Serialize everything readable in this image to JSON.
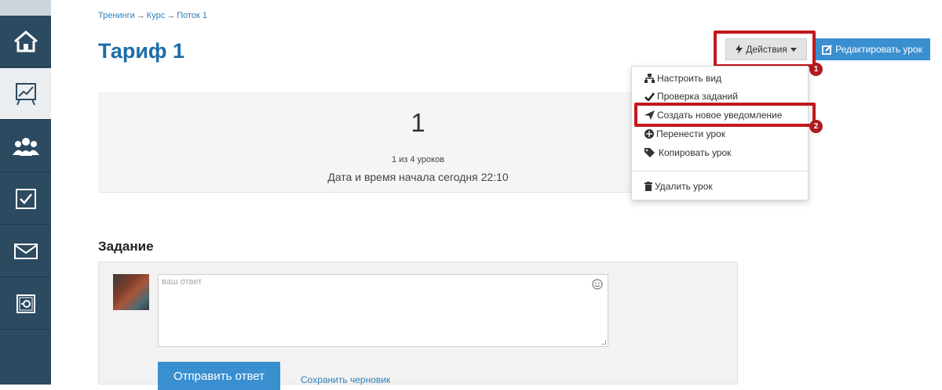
{
  "breadcrumb": {
    "items": [
      "Тренинги",
      "Курс",
      "Поток 1"
    ],
    "separator": "→"
  },
  "page": {
    "title": "Тариф 1"
  },
  "toolbar": {
    "actions_label": "Действия",
    "actions_icon": "bolt-icon",
    "edit_label": "Редактировать урок",
    "edit_icon": "edit-square-icon"
  },
  "callouts": {
    "badge1": "1",
    "badge2": "2",
    "color": "#c2181f"
  },
  "dropdown": {
    "items": [
      {
        "label": "Настроить вид",
        "icon": "sitemap-icon"
      },
      {
        "label": "Проверка заданий",
        "icon": "check-icon"
      },
      {
        "label": "Создать новое уведомление",
        "icon": "send-icon"
      },
      {
        "label": "Перенести урок",
        "icon": "move-icon"
      },
      {
        "label": "Копировать урок",
        "icon": "tags-icon"
      },
      {
        "label": "Удалить урок",
        "icon": "trash-icon"
      }
    ]
  },
  "lesson": {
    "number": "1",
    "progress": "1 из 4 уроков",
    "start": "Дата и время начала сегодня 22:10"
  },
  "task": {
    "title": "Задание",
    "answer_placeholder": "ваш ответ",
    "send_label": "Отправить ответ",
    "draft_label": "Сохранить черновик"
  },
  "sidebar": {
    "items": [
      {
        "icon": "home-icon"
      },
      {
        "icon": "chart-icon"
      },
      {
        "icon": "users-icon"
      },
      {
        "icon": "checkbox-icon"
      },
      {
        "icon": "mail-icon"
      },
      {
        "icon": "safe-icon"
      }
    ]
  },
  "colors": {
    "sidebar": "#2c4a60",
    "accent": "#3a8fd0",
    "title": "#1b6da8"
  }
}
